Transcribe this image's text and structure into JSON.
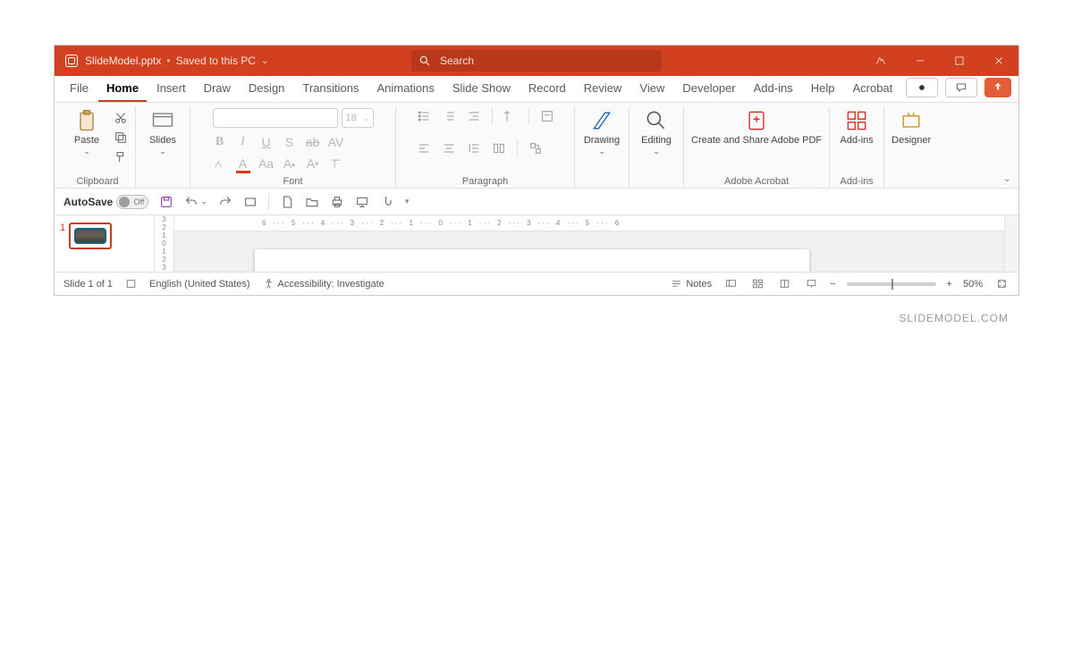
{
  "titlebar": {
    "filename": "SlideModel.pptx",
    "saved_status": "Saved to this PC",
    "search_placeholder": "Search"
  },
  "tabs": [
    "File",
    "Home",
    "Insert",
    "Draw",
    "Design",
    "Transitions",
    "Animations",
    "Slide Show",
    "Record",
    "Review",
    "View",
    "Developer",
    "Add-ins",
    "Help",
    "Acrobat"
  ],
  "active_tab": "Home",
  "ribbon": {
    "clipboard": {
      "label": "Clipboard",
      "paste": "Paste"
    },
    "slides": {
      "label": "Slides",
      "btn": "Slides"
    },
    "font": {
      "label": "Font",
      "size": "18"
    },
    "paragraph": {
      "label": "Paragraph"
    },
    "drawing": {
      "label": "Drawing",
      "btn": "Drawing"
    },
    "editing": {
      "label": "Editing",
      "btn": "Editing"
    },
    "adobe": {
      "label": "Adobe Acrobat",
      "btn": "Create and Share Adobe PDF"
    },
    "addins": {
      "label": "Add-ins",
      "btn": "Add-ins"
    },
    "designer": {
      "btn": "Designer"
    }
  },
  "qat": {
    "autosave_label": "AutoSave",
    "autosave_state": "Off"
  },
  "thumbnail": {
    "number": "1"
  },
  "ruler": {
    "h": [
      "6",
      "5",
      "4",
      "3",
      "2",
      "1",
      "0",
      "1",
      "2",
      "3",
      "4",
      "5",
      "6"
    ],
    "v": [
      "3",
      "2",
      "1",
      "0",
      "1",
      "2",
      "3"
    ]
  },
  "statusbar": {
    "slide": "Slide 1 of 1",
    "language": "English (United States)",
    "accessibility": "Accessibility: Investigate",
    "notes": "Notes",
    "zoom": "50%"
  },
  "watermark": "SLIDEMODEL.COM"
}
